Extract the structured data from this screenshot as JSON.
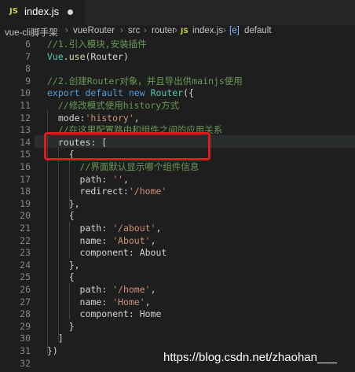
{
  "tab": {
    "icon": "JS",
    "filename": "index.js"
  },
  "breadcrumb": {
    "items": [
      "vue-cli脚手架",
      "vueRouter",
      "src",
      "router"
    ],
    "file_icon": "JS",
    "file": "index.js",
    "symbol_icon": "[e]",
    "symbol": "default"
  },
  "lines": [
    {
      "n": "6",
      "parts": [
        {
          "t": "//1.引入模块,安装插件",
          "c": "com"
        }
      ]
    },
    {
      "n": "7",
      "parts": [
        {
          "t": "Vue",
          "c": "cls"
        },
        {
          "t": ".",
          "c": "plain"
        },
        {
          "t": "use",
          "c": "fn"
        },
        {
          "t": "(Router)",
          "c": "plain"
        }
      ]
    },
    {
      "n": "8",
      "parts": []
    },
    {
      "n": "9",
      "parts": [
        {
          "t": "//2.创建Router对象，并且导出供mainjs使用",
          "c": "com"
        }
      ]
    },
    {
      "n": "10",
      "parts": [
        {
          "t": "export default ",
          "c": "kw"
        },
        {
          "t": "new ",
          "c": "kw"
        },
        {
          "t": "Router",
          "c": "cls"
        },
        {
          "t": "({",
          "c": "plain"
        }
      ]
    },
    {
      "n": "11",
      "parts": [
        {
          "t": "  //修改模式使用history方式",
          "c": "com"
        }
      ]
    },
    {
      "n": "12",
      "parts": [
        {
          "t": "  mode:",
          "c": "plain"
        },
        {
          "t": "'history'",
          "c": "str"
        },
        {
          "t": ",",
          "c": "plain"
        }
      ]
    },
    {
      "n": "13",
      "parts": [
        {
          "t": "  //在这里配置路由和组件之间的应用关系",
          "c": "com"
        }
      ]
    },
    {
      "n": "14",
      "parts": [
        {
          "t": "  routes: [",
          "c": "plain"
        }
      ]
    },
    {
      "n": "15",
      "parts": [
        {
          "t": "    {",
          "c": "plain"
        }
      ]
    },
    {
      "n": "16",
      "parts": [
        {
          "t": "      //界面默认显示哪个组件信息",
          "c": "com"
        }
      ]
    },
    {
      "n": "17",
      "parts": [
        {
          "t": "      path: ",
          "c": "plain"
        },
        {
          "t": "''",
          "c": "str"
        },
        {
          "t": ",",
          "c": "plain"
        }
      ]
    },
    {
      "n": "18",
      "parts": [
        {
          "t": "      redirect:",
          "c": "plain"
        },
        {
          "t": "'/home'",
          "c": "str"
        }
      ]
    },
    {
      "n": "19",
      "parts": [
        {
          "t": "    },",
          "c": "plain"
        }
      ]
    },
    {
      "n": "20",
      "parts": [
        {
          "t": "    {",
          "c": "plain"
        }
      ]
    },
    {
      "n": "21",
      "parts": [
        {
          "t": "      path: ",
          "c": "plain"
        },
        {
          "t": "'/about'",
          "c": "str"
        },
        {
          "t": ",",
          "c": "plain"
        }
      ]
    },
    {
      "n": "22",
      "parts": [
        {
          "t": "      name: ",
          "c": "plain"
        },
        {
          "t": "'About'",
          "c": "str"
        },
        {
          "t": ",",
          "c": "plain"
        }
      ]
    },
    {
      "n": "23",
      "parts": [
        {
          "t": "      component: About",
          "c": "plain"
        }
      ]
    },
    {
      "n": "24",
      "parts": [
        {
          "t": "    },",
          "c": "plain"
        }
      ]
    },
    {
      "n": "25",
      "parts": [
        {
          "t": "    {",
          "c": "plain"
        }
      ]
    },
    {
      "n": "26",
      "parts": [
        {
          "t": "      path: ",
          "c": "plain"
        },
        {
          "t": "'/home'",
          "c": "str"
        },
        {
          "t": ",",
          "c": "plain"
        }
      ]
    },
    {
      "n": "27",
      "parts": [
        {
          "t": "      name: ",
          "c": "plain"
        },
        {
          "t": "'Home'",
          "c": "str"
        },
        {
          "t": ",",
          "c": "plain"
        }
      ]
    },
    {
      "n": "28",
      "parts": [
        {
          "t": "      component: Home",
          "c": "plain"
        }
      ]
    },
    {
      "n": "29",
      "parts": [
        {
          "t": "    }",
          "c": "plain"
        }
      ]
    },
    {
      "n": "30",
      "parts": [
        {
          "t": "  ]",
          "c": "plain"
        }
      ]
    },
    {
      "n": "31",
      "parts": [
        {
          "t": "})",
          "c": "plain"
        }
      ]
    },
    {
      "n": "32",
      "parts": []
    }
  ],
  "watermark": "https://blog.csdn.net/zhaohan___"
}
